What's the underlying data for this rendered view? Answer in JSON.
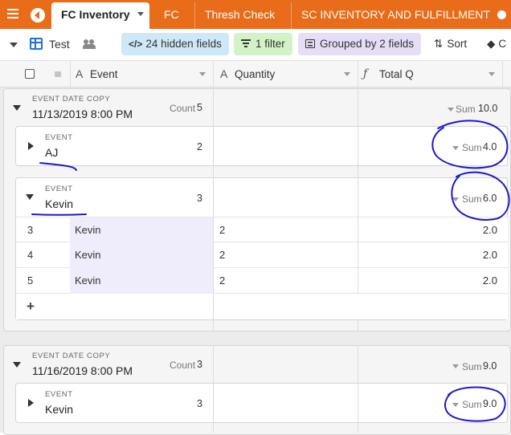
{
  "tabs": {
    "menu_icon": "hamburger-icon",
    "items": [
      {
        "label": ""
      },
      {
        "label": "FC Inventory",
        "active": true
      },
      {
        "label": "FC"
      },
      {
        "label": "Thresh Check"
      },
      {
        "label": "SC INVENTORY AND FULFILLMENT"
      }
    ]
  },
  "toolbar": {
    "view_name": "Test",
    "hidden_fields": "24 hidden fields",
    "filter": "1 filter",
    "grouped": "Grouped by 2 fields",
    "sort": "Sort",
    "color_partial": "C"
  },
  "columns": [
    {
      "label": "Event",
      "icon": "A"
    },
    {
      "label": "Quantity",
      "icon": "A"
    },
    {
      "label": "Total Q",
      "icon": "fx"
    }
  ],
  "groups": [
    {
      "caption": "EVENT DATE COPY",
      "value": "11/13/2019 8:00 PM",
      "count_label": "Count",
      "count": "5",
      "sum_label": "Sum",
      "sum": "10.0",
      "subgroups": [
        {
          "caption": "EVENT",
          "value": "AJ",
          "count": "2",
          "sum_label": "Sum",
          "sum": "4.0",
          "expanded": false
        },
        {
          "caption": "EVENT",
          "value": "Kevin",
          "count": "3",
          "sum_label": "Sum",
          "sum": "6.0",
          "expanded": true,
          "rows": [
            {
              "id": "3",
              "event": "Kevin",
              "quantity": "2",
              "total": "2.0"
            },
            {
              "id": "4",
              "event": "Kevin",
              "quantity": "2",
              "total": "2.0"
            },
            {
              "id": "5",
              "event": "Kevin",
              "quantity": "2",
              "total": "2.0"
            }
          ],
          "add_label": "+"
        }
      ]
    },
    {
      "caption": "EVENT DATE COPY",
      "value": "11/16/2019 8:00 PM",
      "count_label": "Count",
      "count": "3",
      "sum_label": "Sum",
      "sum": "9.0",
      "subgroups": [
        {
          "caption": "EVENT",
          "value": "Kevin",
          "count": "3",
          "sum_label": "Sum",
          "sum": "9.0",
          "expanded": false
        }
      ]
    }
  ],
  "colors": {
    "tab_bar": "#e86c1a",
    "annotation": "#1a1acc",
    "hidden_pill": "#cfe8f7",
    "filter_pill": "#d4f2c7",
    "group_pill": "#e6def7"
  }
}
